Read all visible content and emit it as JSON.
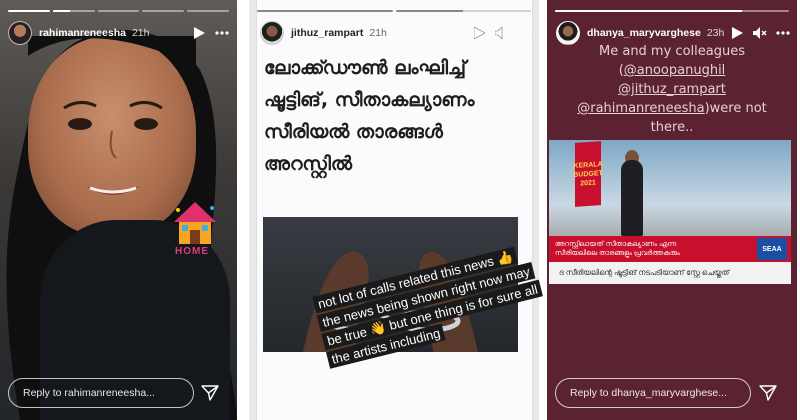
{
  "stories": [
    {
      "username": "rahimanreneesha",
      "time": "21h",
      "reply_placeholder": "Reply to rahimanreneesha...",
      "progress": [
        1.0,
        0.4,
        0,
        0,
        0
      ],
      "sticker_text": "HOME"
    },
    {
      "username": "jithuz_rampart",
      "time": "21h",
      "reply_placeholder": "",
      "headline": "ലോക്ക്ഡൗൺ ലംഘിച്ച് ഷൂട്ടിങ്, സീതാകല്യാണം സീരിയൽ താരങ്ങൾ അറസ്റ്റിൽ",
      "caption": "not lot of calls related this news 👍 the news being shown right now may be true 👋 but one thing is for sure all the artists including",
      "progress": [
        1.0,
        0.5
      ]
    },
    {
      "username": "dhanya_maryvarghese",
      "time": "23h",
      "reply_placeholder": "Reply to dhanya_maryvarghese...",
      "progress": [
        0.8
      ],
      "text_lines": {
        "line1": "Me and my colleagues",
        "mention1": "@anoopanughil",
        "mention2": "@jithuz_rampart",
        "mention3": "@rahimanreneesha",
        "tail": ")were not there.."
      },
      "tv": {
        "logo": "KERALA BUDGET 2021",
        "red_line1": "അറസ്റ്റിലായത് സീതാകല്യാണം എന്ന",
        "red_line2": "സീരിയലിലെ താരങ്ങളും പ്രവർത്തകരും",
        "white_line": "ദ സീരിയലിന്റെ ഷൂട്ടിങ് നടപടിയാണ് സ്റ്റേ ചെയ്തത്",
        "badge": "SEAA"
      }
    }
  ],
  "colors": {
    "story3_bg": "#5b2331",
    "news_red": "#c8102e"
  },
  "icons": [
    "play-icon",
    "mute-icon",
    "more-icon",
    "send-icon"
  ]
}
